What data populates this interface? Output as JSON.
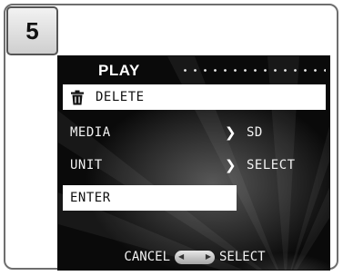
{
  "step": "5",
  "menu": {
    "title": "PLAY",
    "items": [
      {
        "label": "DELETE",
        "icon": "trash-icon",
        "selected": true
      },
      {
        "label": "MEDIA",
        "value": "SD"
      },
      {
        "label": "UNIT",
        "value": "SELECT"
      },
      {
        "label": "ENTER",
        "selected": true
      }
    ]
  },
  "footer": {
    "cancel": "CANCEL",
    "select": "SELECT"
  },
  "colors": {
    "highlight": "#ffffff",
    "screen_bg": "#1a1a1a",
    "text": "#f2f2f2"
  }
}
